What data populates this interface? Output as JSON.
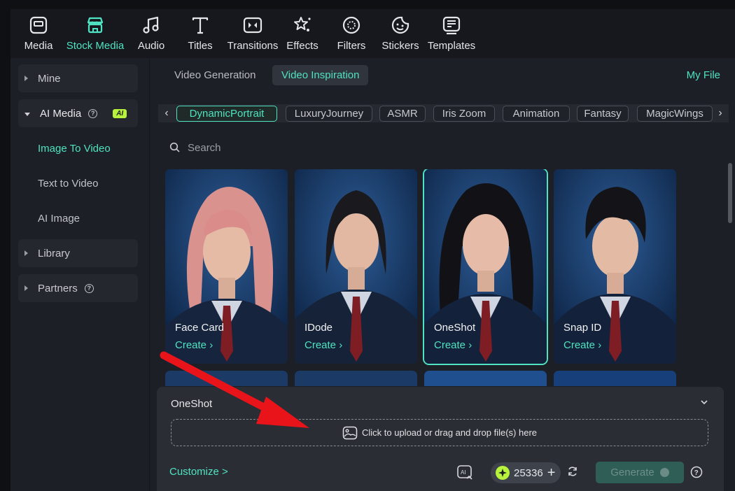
{
  "toolbar": [
    {
      "label": "Media",
      "icon": "media-icon"
    },
    {
      "label": "Stock Media",
      "icon": "stock-media-icon",
      "active": true
    },
    {
      "label": "Audio",
      "icon": "music-note-icon"
    },
    {
      "label": "Titles",
      "icon": "text-t-icon"
    },
    {
      "label": "Transitions",
      "icon": "transition-icon"
    },
    {
      "label": "Effects",
      "icon": "effects-star-icon"
    },
    {
      "label": "Filters",
      "icon": "filter-icon"
    },
    {
      "label": "Stickers",
      "icon": "sticker-icon"
    },
    {
      "label": "Templates",
      "icon": "template-icon"
    }
  ],
  "sidebar": {
    "mine": "Mine",
    "ai_media": "AI Media",
    "ai_badge": "AI",
    "image_to_video": "Image To Video",
    "text_to_video": "Text to Video",
    "ai_image": "AI Image",
    "library": "Library",
    "partners": "Partners"
  },
  "subtabs": {
    "generation": "Video Generation",
    "inspiration": "Video Inspiration",
    "my_file": "My File"
  },
  "chips": [
    "DynamicPortrait",
    "LuxuryJourney",
    "ASMR",
    "Iris Zoom",
    "Animation",
    "Fantasy",
    "MagicWings"
  ],
  "search": {
    "placeholder": "Search"
  },
  "cards": [
    {
      "name": "Face Card",
      "create": "Create ›"
    },
    {
      "name": "IDode",
      "create": "Create ›"
    },
    {
      "name": "OneShot",
      "create": "Create ›",
      "selected": true
    },
    {
      "name": "Snap ID",
      "create": "Create ›"
    }
  ],
  "panel": {
    "title": "OneShot",
    "upload_text": "Click to upload or drag and drop file(s) here",
    "customize": "Customize >",
    "credits": "25336",
    "generate": "Generate"
  },
  "colors": {
    "accent": "#4fe3c1",
    "badge": "#b7f23d",
    "arrow": "#e8141a"
  }
}
